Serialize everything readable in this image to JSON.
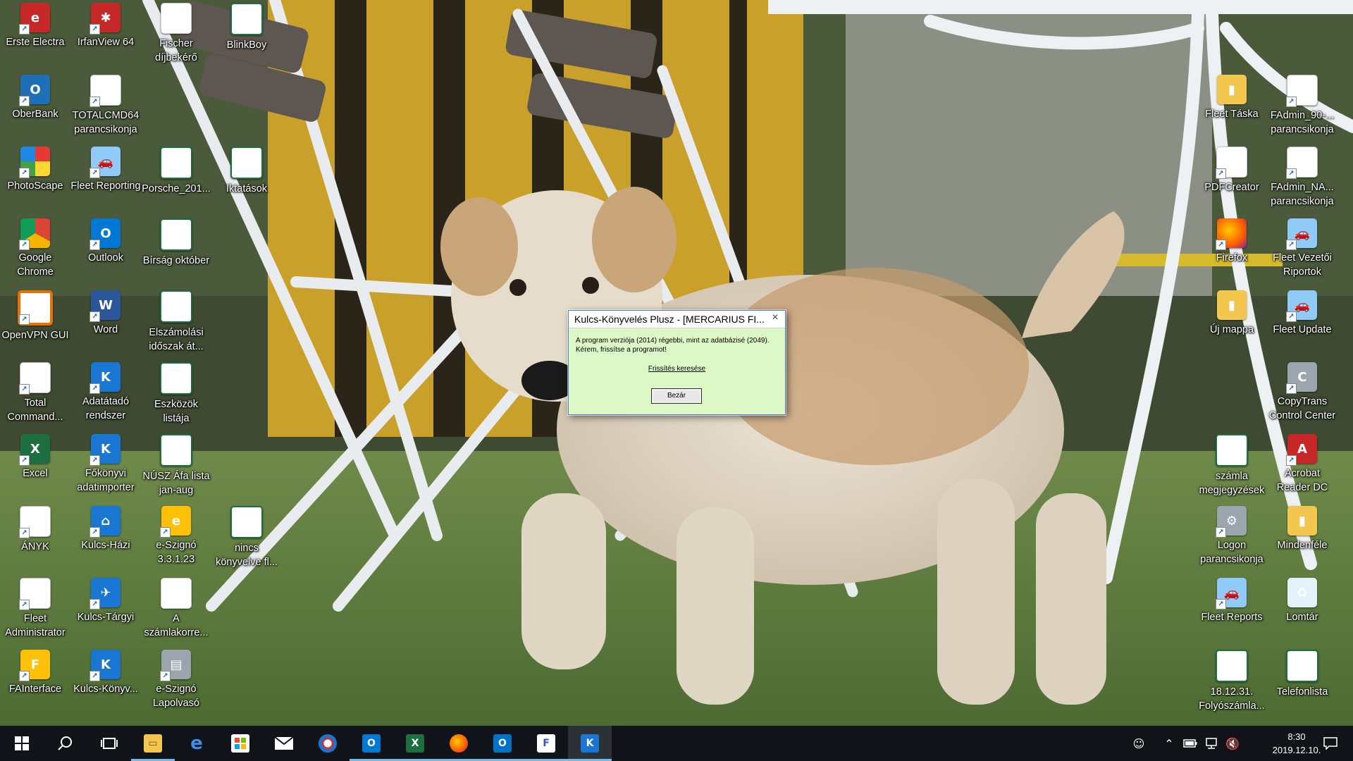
{
  "desktop": {
    "icons": [
      {
        "label": "Erste Electra",
        "icon": "erste-electra-icon"
      },
      {
        "label": "IrfanView 64",
        "icon": "irfanview-icon"
      },
      {
        "label": "Fischer díjbekérő",
        "icon": "pdf-file-icon"
      },
      {
        "label": "BlinkBoy",
        "icon": "excel-file-icon"
      },
      {
        "label": "OberBank",
        "icon": "oberbank-icon"
      },
      {
        "label": "TOTALCMD64 parancsikonja",
        "icon": "total-commander-icon"
      },
      {
        "label": "PhotoScape",
        "icon": "photoscape-icon"
      },
      {
        "label": "Fleet Reporting",
        "icon": "fleet-car-icon"
      },
      {
        "label": "Porsche_201...",
        "icon": "excel-file-icon"
      },
      {
        "label": "Iktatások",
        "icon": "excel-file-icon"
      },
      {
        "label": "Google Chrome",
        "icon": "chrome-icon"
      },
      {
        "label": "Outlook",
        "icon": "outlook-icon"
      },
      {
        "label": "Bírság október",
        "icon": "excel-file-icon"
      },
      {
        "label": "OpenVPN GUI",
        "icon": "openvpn-icon"
      },
      {
        "label": "Word",
        "icon": "word-icon"
      },
      {
        "label": "Elszámolási időszak át...",
        "icon": "excel-file-icon"
      },
      {
        "label": "Total Command...",
        "icon": "total-commander-icon"
      },
      {
        "label": "Adatátadó rendszer",
        "icon": "kulcs-app-icon"
      },
      {
        "label": "Eszközök listája",
        "icon": "excel-file-icon"
      },
      {
        "label": "Excel",
        "icon": "excel-app-icon"
      },
      {
        "label": "Főkönyvi adatimporter",
        "icon": "kulcs-app-icon"
      },
      {
        "label": "NÚSZ Áfa lista jan-aug",
        "icon": "excel-file-icon"
      },
      {
        "label": "ÁNYK",
        "icon": "anyk-icon"
      },
      {
        "label": "Kulcs-Házi",
        "icon": "kulcs-hazi-icon"
      },
      {
        "label": "e-Szignó 3.3.1.23",
        "icon": "e-szigno-icon"
      },
      {
        "label": "nincs könyvelve fl...",
        "icon": "excel-file-icon"
      },
      {
        "label": "Fleet Administrator",
        "icon": "fleet-admin-icon"
      },
      {
        "label": "Kulcs-Tárgyi",
        "icon": "kulcs-targyi-icon"
      },
      {
        "label": "A számlakorre...",
        "icon": "pdf-file-icon"
      },
      {
        "label": "FAInterface",
        "icon": "fainterface-icon"
      },
      {
        "label": "Kulcs-Könyv...",
        "icon": "kulcs-konyveles-icon"
      },
      {
        "label": "e-Szignó Lapolvasó",
        "icon": "scanner-icon"
      },
      {
        "label": "Fleet Táska",
        "icon": "folder-icon"
      },
      {
        "label": "FAdmin_90-... parancsikonja",
        "icon": "fadmin-icon"
      },
      {
        "label": "PDFCreator",
        "icon": "pdfcreator-icon"
      },
      {
        "label": "FAdmin_NA... parancsikonja",
        "icon": "fadmin-icon"
      },
      {
        "label": "Firefox",
        "icon": "firefox-icon"
      },
      {
        "label": "Fleet Vezetői Riportok",
        "icon": "fleet-car-icon"
      },
      {
        "label": "Új mappa",
        "icon": "folder-icon"
      },
      {
        "label": "Fleet Update",
        "icon": "fleet-car-icon"
      },
      {
        "label": "CopyTrans Control Center",
        "icon": "copytrans-icon"
      },
      {
        "label": "számla megjegyzések",
        "icon": "excel-file-icon"
      },
      {
        "label": "Acrobat Reader DC",
        "icon": "acrobat-icon"
      },
      {
        "label": "Logon parancsikonja",
        "icon": "logon-icon"
      },
      {
        "label": "Mindenféle",
        "icon": "folder-icon"
      },
      {
        "label": "Fleet Reports",
        "icon": "fleet-car-icon"
      },
      {
        "label": "Lomtár",
        "icon": "recycle-bin-icon"
      },
      {
        "label": "18.12.31. Folyószámla...",
        "icon": "excel-file-icon"
      },
      {
        "label": "Telefonlista",
        "icon": "excel-file-icon"
      }
    ]
  },
  "dialog": {
    "title": "Kulcs-Könyvelés Plusz - [MERCARIUS FI...",
    "close_glyph": "×",
    "message": "A program verziója (2014) régebbi, mint az adatbázisé (2049). Kérem, frissítse a programot!",
    "link": "Frissítés keresése",
    "button": "Bezár",
    "background_color": "#dcf8c6"
  },
  "taskbar": {
    "items": [
      {
        "icon": "windows-start-icon"
      },
      {
        "icon": "search-icon"
      },
      {
        "icon": "task-view-icon"
      },
      {
        "icon": "file-explorer-icon"
      },
      {
        "icon": "edge-icon"
      },
      {
        "icon": "store-icon"
      },
      {
        "icon": "mail-icon"
      },
      {
        "icon": "paint-icon"
      },
      {
        "icon": "outlook-icon"
      },
      {
        "icon": "excel-icon"
      },
      {
        "icon": "firefox-icon"
      },
      {
        "icon": "outlook-icon"
      },
      {
        "icon": "fleet-admin-icon"
      },
      {
        "icon": "kulcs-konyveles-icon"
      }
    ],
    "tray": {
      "icons": [
        "people-icon",
        "chevron-up-icon",
        "battery-icon",
        "network-icon",
        "volume-muted-icon",
        "notification-icon"
      ],
      "time": "8:30",
      "date": "2019.12.10."
    }
  }
}
